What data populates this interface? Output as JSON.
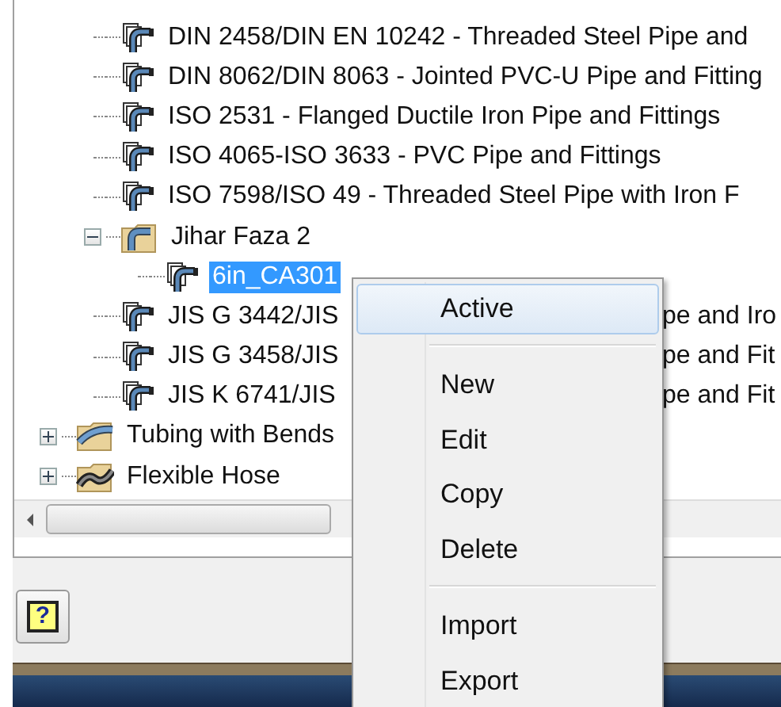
{
  "tree": {
    "items": [
      {
        "children": [
          {
            "kind": "style",
            "label": "DIN 2458/DIN EN 10242 - Threaded Steel Pipe and",
            "selected": false
          },
          {
            "kind": "style",
            "label": "DIN 8062/DIN 8063 - Jointed PVC-U Pipe and Fitting",
            "selected": false
          },
          {
            "kind": "style",
            "label": "ISO 2531 - Flanged Ductile Iron Pipe and Fittings",
            "selected": false
          },
          {
            "kind": "style",
            "label": "ISO 4065-ISO 3633 - PVC Pipe and Fittings",
            "selected": false
          },
          {
            "kind": "style",
            "label": "ISO 7598/ISO 49 - Threaded Steel Pipe with Iron F",
            "selected": false
          },
          {
            "kind": "pipe_folder",
            "label": "Jihar Faza 2",
            "expanded": true,
            "selected": false,
            "children": [
              {
                "kind": "style",
                "label": "6in_CA301",
                "selected": true
              }
            ]
          },
          {
            "kind": "style",
            "label": "JIS G 3442/JIS",
            "label_after_menu": "pe and Iro",
            "selected": false
          },
          {
            "kind": "style",
            "label": "JIS G 3458/JIS",
            "label_after_menu": "pe and Fit",
            "selected": false
          },
          {
            "kind": "style",
            "label": "JIS K 6741/JIS",
            "label_after_menu": "pe and Fit",
            "selected": false
          }
        ]
      },
      {
        "kind": "tube_folder",
        "label": "Tubing with Bends",
        "expanded": false,
        "selected": false
      },
      {
        "kind": "hose_folder",
        "label": "Flexible Hose",
        "expanded": false,
        "selected": false
      }
    ]
  },
  "help_button": {
    "glyph": "?"
  },
  "context_menu": {
    "items": [
      {
        "kind": "item",
        "label": "Active",
        "selected": true
      },
      {
        "kind": "separator"
      },
      {
        "kind": "item",
        "label": "New",
        "selected": false
      },
      {
        "kind": "item",
        "label": "Edit",
        "selected": false
      },
      {
        "kind": "item",
        "label": "Copy",
        "selected": false
      },
      {
        "kind": "item",
        "label": "Delete",
        "selected": false
      },
      {
        "kind": "separator"
      },
      {
        "kind": "item",
        "label": "Import",
        "selected": false
      },
      {
        "kind": "item",
        "label": "Export",
        "selected": false
      }
    ]
  }
}
